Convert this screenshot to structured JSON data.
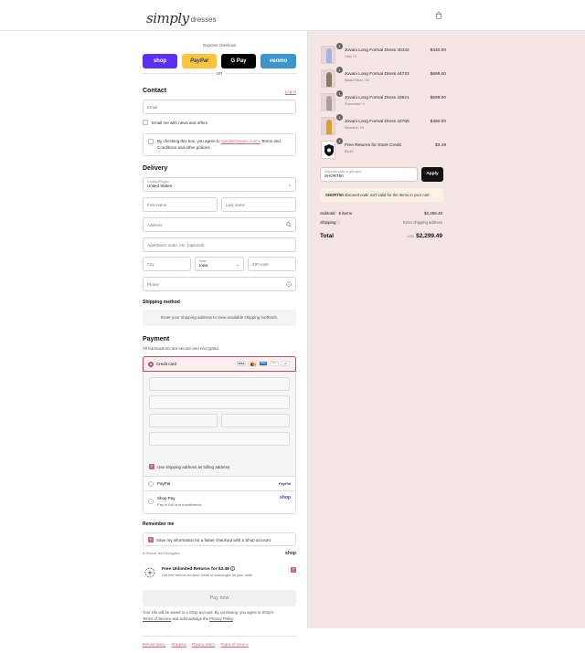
{
  "header": {
    "logo_script": "simply",
    "logo_word": "dresses",
    "bag_icon": "bag-icon"
  },
  "express": {
    "title": "Express checkout",
    "or": "OR",
    "buttons": [
      {
        "label": "shop",
        "color": "#5a31f4"
      },
      {
        "label": "PayPal",
        "color": "#ffc439"
      },
      {
        "label": "G Pay",
        "color": "#000000"
      },
      {
        "label": "venmo",
        "color": "#3d95ce"
      }
    ]
  },
  "contact": {
    "title": "Contact",
    "login": "Log in",
    "email_placeholder": "Email",
    "news_label": "Email me with news and offers",
    "terms_prefix": "By checking this box, you agree to ",
    "terms_link": "SimplyDresses.com's",
    "terms_suffix": " Terms and Conditions and other policies."
  },
  "delivery": {
    "title": "Delivery",
    "country_label": "Country/Region",
    "country_value": "United States",
    "first_name": "First name",
    "last_name": "Last name",
    "address": "Address",
    "apartment": "Apartment, suite, etc. (optional)",
    "city": "City",
    "state_label": "State",
    "state_value": "Iowa",
    "zip": "ZIP code",
    "phone": "Phone"
  },
  "shipping": {
    "title": "Shipping method",
    "note": "Enter your shipping address to view available shipping methods."
  },
  "payment": {
    "title": "Payment",
    "subtitle": "All transactions are secure and encrypted.",
    "credit_card": "Credit card",
    "card_badges": [
      "VISA",
      "MC",
      "AMEX",
      "DISC",
      "+5"
    ],
    "billing_label": "Use shipping address as billing address",
    "paypal": "PayPal",
    "paypal_badge": "PayPal",
    "shoppay": "Shop Pay",
    "shoppay_sub": "Pay in full or in installments",
    "shoppay_badge": "shop"
  },
  "remember": {
    "title": "Remember me",
    "save_label": "Save my information for a faster checkout with a Shop account",
    "secure": "Secure and encrypted",
    "shop_logo": "shop"
  },
  "returns": {
    "title": "Free Unlimited Returns for $3.49",
    "info_icon": "i",
    "sub": "Get free returns for store credit or exchanges on your order"
  },
  "pay_now": "Pay now",
  "legal": {
    "line1": "Your info will be saved to a Shop account. By continuing, you agree to Shop's",
    "tos": "Terms of Service",
    "and": " and acknowledge the ",
    "privacy": "Privacy Policy",
    "period": "."
  },
  "footer_links": [
    "Refund policy",
    "Shipping",
    "Privacy policy",
    "Terms of service"
  ],
  "cart": {
    "items": [
      {
        "name": "Jovani Long Formal Dress 40432",
        "sub": "Lilac / 0",
        "price": "$440.00",
        "qty": "1",
        "color": "#9fb7dd"
      },
      {
        "name": "Jovani Long Formal Dress 44723",
        "sub": "Black/Silver / 00",
        "price": "$699.00",
        "qty": "1",
        "color": "#8a7a6a"
      },
      {
        "name": "Jovani Long Formal Dress 43921",
        "sub": "Gunmetal / 0",
        "price": "$699.00",
        "qty": "1",
        "color": "#a7a0a8"
      },
      {
        "name": "Jovani Long Formal Dress 42765",
        "sub": "Mustard / 00",
        "price": "$460.00",
        "qty": "1",
        "color": "#d8a030"
      },
      {
        "name": "Free Returns for Store Credit",
        "sub": "$3.49",
        "price": "$3.49",
        "qty": "1",
        "color": "#111111"
      }
    ],
    "discount_label": "Discount code or gift card",
    "discount_value": "SHORT50",
    "apply": "Apply",
    "error_code": "SHORT50",
    "error_msg": " discount code isn't valid for the items in your cart",
    "subtotal_label": "Subtotal · 5 items",
    "subtotal": "$2,299.49",
    "shipping_label": "Shipping",
    "shipping_value": "Enter shipping address",
    "total_label": "Total",
    "currency": "USD",
    "total": "$2,299.49"
  }
}
